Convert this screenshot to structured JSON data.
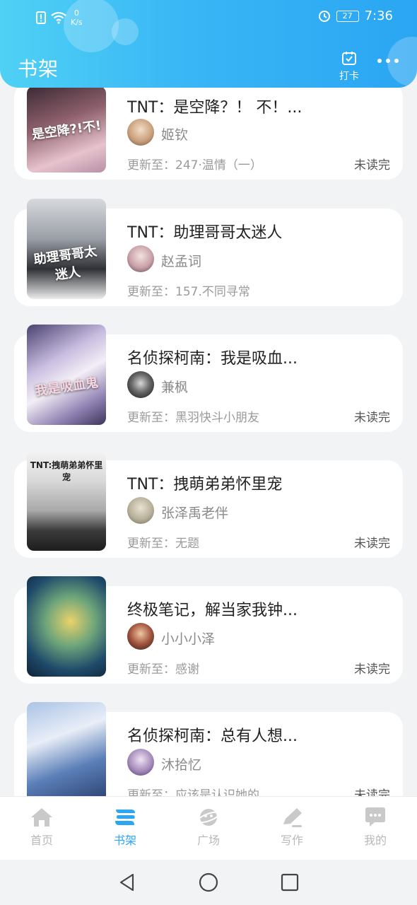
{
  "status_bar": {
    "net_speed": "0",
    "net_unit": "K/s",
    "battery": "27",
    "time": "7:36"
  },
  "header": {
    "title": "书架",
    "checkin_label": "打卡"
  },
  "books": [
    {
      "title": "TNT：是空降？！ 不！...",
      "author": "姬钦",
      "update": "更新至：247·温情（一）",
      "status": "未读完",
      "cover_text": "是空降?!不!"
    },
    {
      "title": "TNT：助理哥哥太迷人",
      "author": "赵孟词",
      "update": "更新至：157.不同寻常",
      "status": "",
      "cover_text": "助理哥哥太迷人"
    },
    {
      "title": "名侦探柯南：我是吸血...",
      "author": "兼枫",
      "update": "更新至：黑羽快斗小朋友",
      "status": "未读完",
      "cover_text": "我是吸血鬼"
    },
    {
      "title": "TNT：拽萌弟弟怀里宠",
      "author": "张泽禹老伴",
      "update": "更新至：无题",
      "status": "未读完",
      "cover_text": "TNT:拽萌弟弟怀里宠"
    },
    {
      "title": "终极笔记，解当家我钟...",
      "author": "小小小泽",
      "update": "更新至：感谢",
      "status": "未读完",
      "cover_text": ""
    },
    {
      "title": "名侦探柯南：总有人想...",
      "author": "沐拾忆",
      "update": "更新至：应该是认识她的",
      "status": "未读完",
      "cover_text": ""
    }
  ],
  "bottom_nav": [
    {
      "label": "首页",
      "icon": "home-icon",
      "active": false
    },
    {
      "label": "书架",
      "icon": "bookshelf-icon",
      "active": true
    },
    {
      "label": "广场",
      "icon": "planet-icon",
      "active": false
    },
    {
      "label": "写作",
      "icon": "pen-icon",
      "active": false
    },
    {
      "label": "我的",
      "icon": "chat-bubble-icon",
      "active": false
    }
  ],
  "colors": {
    "accent": "#2aa6f3",
    "header_gradient_start": "#4fd1f5",
    "inactive_nav": "#b8b8b8"
  }
}
